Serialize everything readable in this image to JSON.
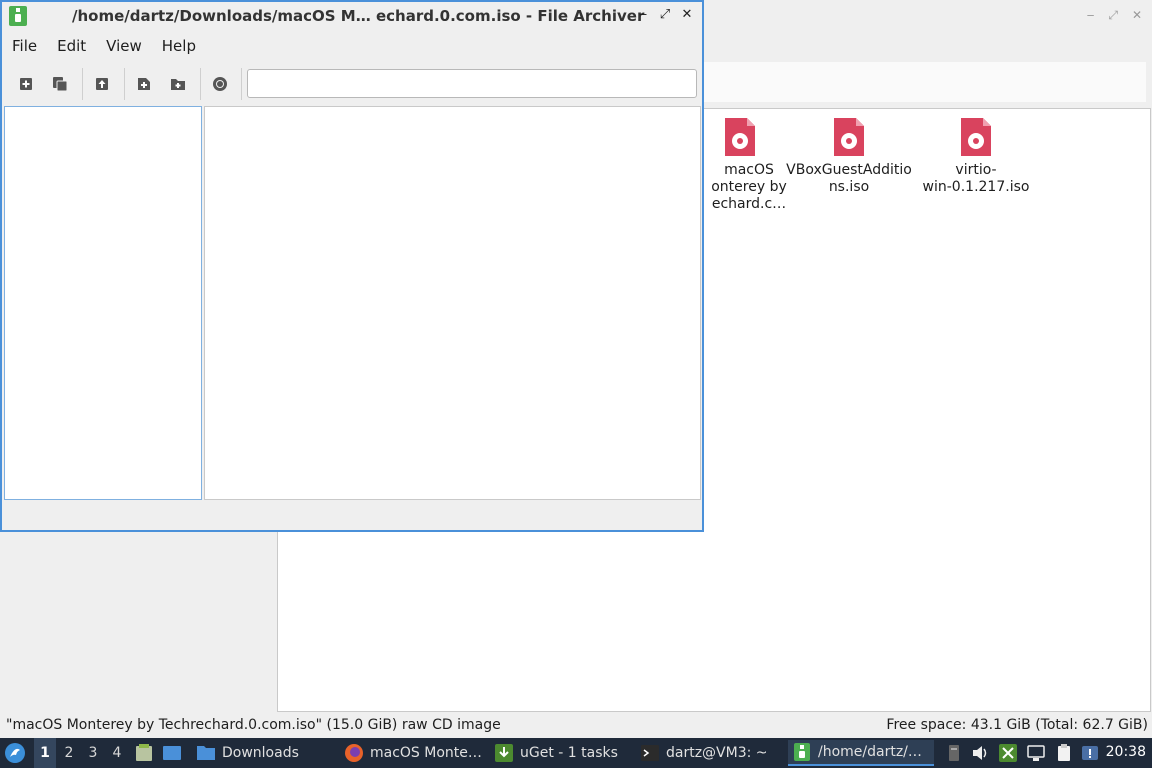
{
  "file_manager": {
    "files": [
      {
        "label": "macOS\nonterey by\nechard.c…"
      },
      {
        "label": "VBoxGuestAdditions.iso"
      },
      {
        "label": "virtio-\nwin-0.1.217.iso"
      }
    ],
    "status_left": "\"macOS Monterey by Techrechard.0.com.iso\" (15.0 GiB) raw CD image",
    "status_right": "Free space: 43.1 GiB (Total: 62.7 GiB)"
  },
  "archiver": {
    "title": "/home/dartz/Downloads/macOS M… echard.0.com.iso - File Archiver",
    "menu": [
      "File",
      "Edit",
      "View",
      "Help"
    ],
    "location_value": "",
    "window_buttons": {
      "minimize": "‒",
      "maximize": "⤢",
      "close": "✕"
    }
  },
  "taskbar": {
    "workspaces": [
      "1",
      "2",
      "3",
      "4"
    ],
    "active_workspace": "1",
    "tasks": [
      {
        "label": "Downloads",
        "icon": "folder-icon"
      },
      {
        "label": "macOS Monte…",
        "icon": "firefox-icon"
      },
      {
        "label": "uGet - 1 tasks",
        "icon": "uget-icon"
      },
      {
        "label": "dartz@VM3: ~",
        "icon": "terminal-icon"
      },
      {
        "label": "/home/dartz/…",
        "icon": "archiver-icon"
      }
    ],
    "clock": "20:38"
  },
  "colors": {
    "accent": "#4a90d9",
    "iso_icon": "#d9435e",
    "taskbar_bg": "#1f2a3a"
  }
}
